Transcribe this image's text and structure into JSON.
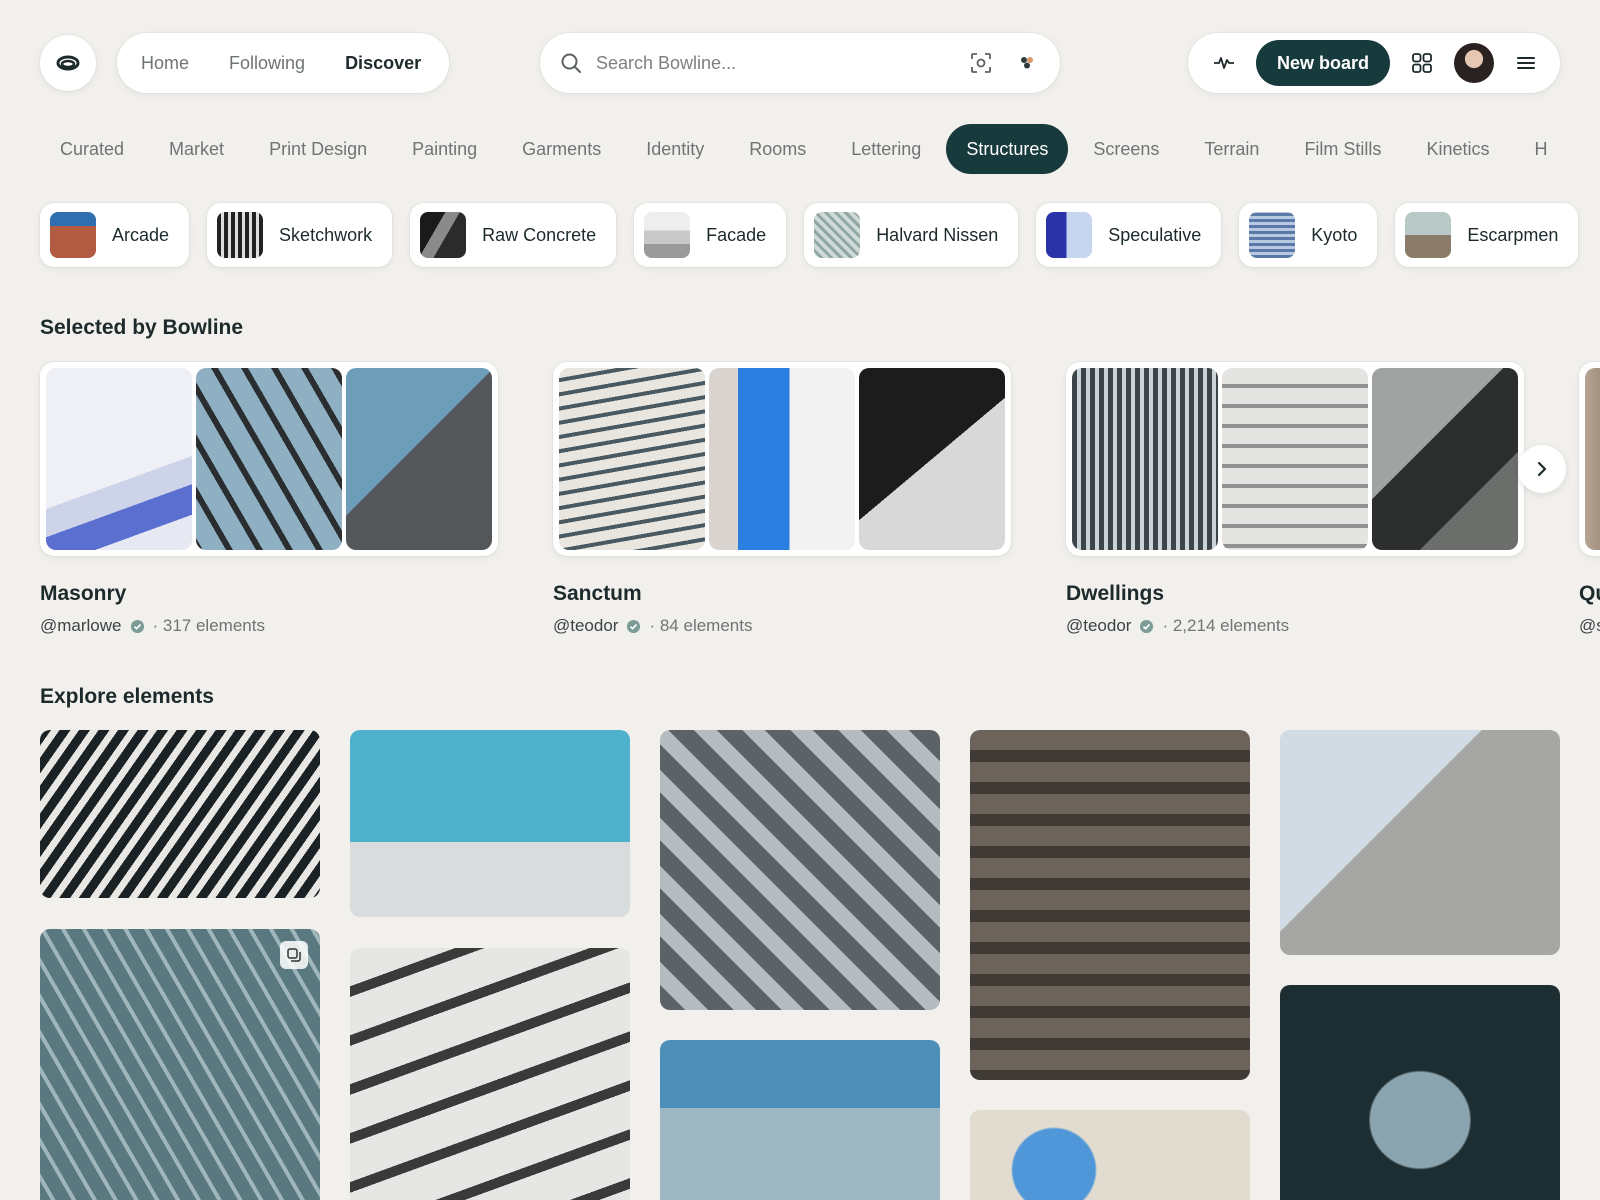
{
  "nav": {
    "home": "Home",
    "following": "Following",
    "discover": "Discover"
  },
  "search": {
    "placeholder": "Search Bowline..."
  },
  "toolbar": {
    "new_board": "New board"
  },
  "categories": [
    "Curated",
    "Market",
    "Print Design",
    "Painting",
    "Garments",
    "Identity",
    "Rooms",
    "Lettering",
    "Structures",
    "Screens",
    "Terrain",
    "Film Stills",
    "Kinetics",
    "H"
  ],
  "active_category": "Structures",
  "chips": [
    "Arcade",
    "Sketchwork",
    "Raw Concrete",
    "Facade",
    "Halvard Nissen",
    "Speculative",
    "Kyoto",
    "Escarpmen"
  ],
  "selected": {
    "title": "Selected by Bowline",
    "boards": [
      {
        "name": "Masonry",
        "handle": "@marlowe",
        "count": "· 317 elements"
      },
      {
        "name": "Sanctum",
        "handle": "@teodor",
        "count": "· 84 elements"
      },
      {
        "name": "Dwellings",
        "handle": "@teodor",
        "count": "· 2,214 elements"
      },
      {
        "name": "Qu",
        "handle": "@s",
        "count": ""
      }
    ]
  },
  "explore": {
    "title": "Explore elements"
  },
  "colors": {
    "accent": "#173a3d",
    "background": "#f2f0ec",
    "verified": "#7d9c96"
  }
}
